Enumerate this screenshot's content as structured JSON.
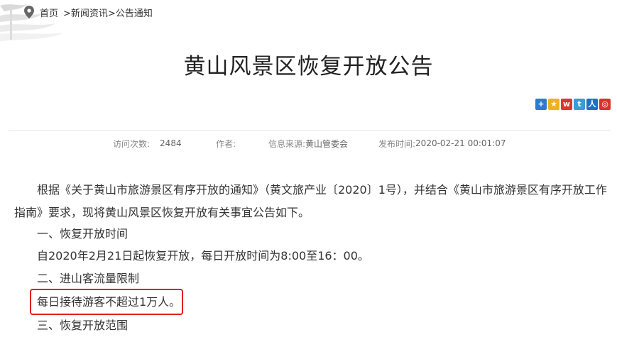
{
  "breadcrumb": {
    "home": "首页",
    "news": ">新闻资讯",
    "notice": ">公告通知"
  },
  "article": {
    "title": "黄山风景区恢复开放公告",
    "meta": {
      "visits_label": "访问次数:",
      "visits_value": "2484",
      "author_label": "作者:",
      "author_value": "",
      "source_label": "信息来源:",
      "source_value": "黄山管委会",
      "published_label": "发布时间:",
      "published_value": "2020-02-21 00:01:07"
    },
    "paragraph1": "根据《关于黄山市旅游景区有序开放的通知》（黄文旅产业〔2020〕1号），并结合《黄山市旅游景区有序开放工作指南》要求，现将黄山风景区恢复开放有关事宜公告如下。",
    "section1_heading": "一、恢复开放时间",
    "section1_text": "自2020年2月21日起恢复开放，每日开放时间为8:00至16：00。",
    "section2_heading": "二、进山客流量限制",
    "section2_text": "每日接待游客不超过1万人。",
    "section3_heading": "三、恢复开放范围"
  },
  "share_icons": [
    "share-plus-icon",
    "qzone-icon",
    "weibo-icon",
    "tencent-weibo-icon",
    "renren-icon",
    "more-share-icon"
  ],
  "colors": {
    "highlight": "#e0201a",
    "divider": "#e6e6e6",
    "meta_text": "#888888"
  }
}
